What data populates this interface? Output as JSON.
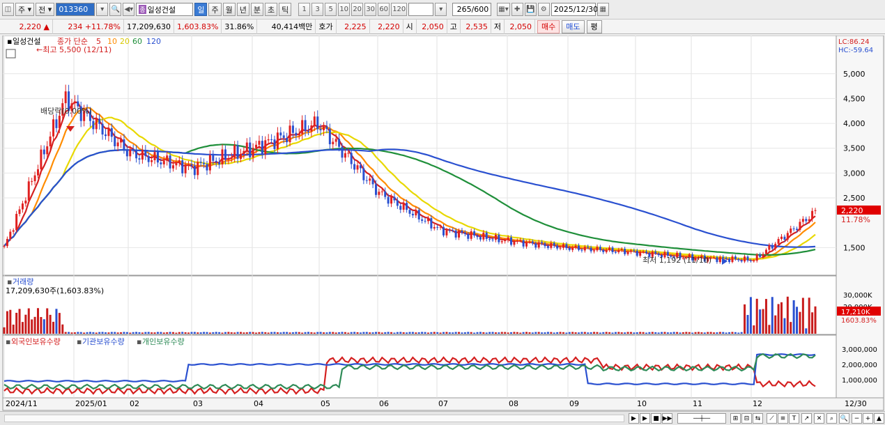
{
  "toolbar": {
    "type_select": "주",
    "period_select": "전",
    "stock_code": "013360",
    "stock_name": "일성건설",
    "name_tag": "종",
    "periods": [
      "일",
      "주",
      "월",
      "년",
      "분",
      "초",
      "틱"
    ],
    "active_period": "일",
    "intervals": [
      "1",
      "3",
      "5",
      "10",
      "20",
      "30",
      "60",
      "120"
    ],
    "count": "265",
    "count_total": "/600",
    "date": "2025/12/30"
  },
  "pricebar": {
    "price": "2,220",
    "change": "234",
    "change_pct": "+11.78%",
    "volume": "17,209,630",
    "volume_pct": "1,603.83%",
    "turnover": "31.86%",
    "amount": "40,414백만",
    "quote_label": "호가",
    "ask": "2,225",
    "bid": "2,220",
    "open_label": "시",
    "open": "2,050",
    "high_label": "고",
    "high": "2,535",
    "low_label": "저",
    "low": "2,050",
    "buy_label": "매수",
    "sell_label": "매도",
    "eval_label": "평"
  },
  "price_panel": {
    "stock_label": "일성건설",
    "ma_title": "종가 단순",
    "ma_periods": [
      "5",
      "10",
      "20",
      "60",
      "120"
    ],
    "ma_colors": [
      "#d42020",
      "#ff8c00",
      "#e8d800",
      "#1f8f3a",
      "#2a50d0"
    ],
    "high_marker": "최고 5,500 (12/11)",
    "low_marker": "최저 1,192 (11/10)",
    "ex_dividend": "배당락(0.00%)",
    "lc": "LC:86.24",
    "hc": "HC:-59.64",
    "current_price_tag": "2,220",
    "current_pct_tag": "11.78%",
    "y_ticks": [
      "5,000",
      "4,500",
      "4,000",
      "3,500",
      "3,000",
      "2,500",
      "1,500"
    ]
  },
  "volume_panel": {
    "title": "거래량",
    "subtitle": "17,209,630주(1,603.83%)",
    "y_ticks": [
      "30,000K",
      "20,000K"
    ],
    "current_tag": "17,210K",
    "current_pct": "1603.83%"
  },
  "holdings_panel": {
    "legends": [
      "외국인보유수량",
      "기관보유수량",
      "개인보유수량"
    ],
    "colors": [
      "#d42020",
      "#2a50d0",
      "#2e8b57"
    ],
    "y_ticks": [
      "3,000,000",
      "2,000,000",
      "1,000,000"
    ]
  },
  "x_axis": {
    "labels": [
      "2024/11",
      "2025/01",
      "02",
      "03",
      "04",
      "05",
      "06",
      "07",
      "08",
      "09",
      "10",
      "11",
      "12"
    ],
    "end_label": "12/30"
  },
  "chart_data": {
    "type": "candlestick",
    "candles_close_approx": [
      {
        "month": "2024/11",
        "close": 1500
      },
      {
        "month": "2024/12",
        "close": 4500
      },
      {
        "month": "2025/01",
        "close": 3400
      },
      {
        "month": "2025/02",
        "close": 3100
      },
      {
        "month": "2025/03",
        "close": 3500
      },
      {
        "month": "2025/04",
        "close": 4000
      },
      {
        "month": "2025/05",
        "close": 2600
      },
      {
        "month": "2025/06",
        "close": 1850
      },
      {
        "month": "2025/07",
        "close": 1650
      },
      {
        "month": "2025/08",
        "close": 1500
      },
      {
        "month": "2025/09",
        "close": 1420
      },
      {
        "month": "2025/10",
        "close": 1300
      },
      {
        "month": "2025/11",
        "close": 1250
      },
      {
        "month": "2025/12",
        "close": 2220
      }
    ],
    "y_range": [
      1000,
      5600
    ],
    "volume_range_k": [
      0,
      37000
    ],
    "holdings_range": [
      0,
      3600000
    ]
  }
}
